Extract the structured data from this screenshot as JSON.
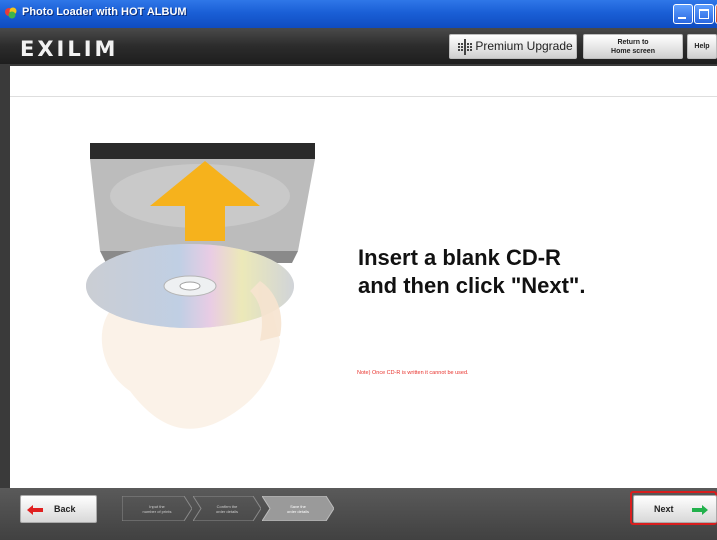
{
  "window": {
    "title": "Photo Loader with HOT ALBUM",
    "controls": [
      "minimize-icon",
      "maximize-icon",
      "close-icon"
    ]
  },
  "header": {
    "logo": "EXILIM",
    "premium_label": "Premium Upgrade",
    "home_label_line1": "Return to",
    "home_label_line2": "Home screen",
    "help_label": "Help"
  },
  "main": {
    "headline_line1": "Insert a blank CD-R",
    "headline_line2": "and then click \"Next\".",
    "note": "Note) Once CD-R is written it cannot be used."
  },
  "footer": {
    "back_label": "Back",
    "next_label": "Next",
    "steps": [
      {
        "line1": "Input the",
        "line2": "number of prints",
        "active": false
      },
      {
        "line1": "Confirm the",
        "line2": "order details",
        "active": false
      },
      {
        "line1": "Save the",
        "line2": "order details",
        "active": true
      }
    ]
  },
  "colors": {
    "titlebar": "#1a5fd6",
    "header": "#2c2c2c",
    "note_red": "#e8322c",
    "back_arrow": "#e02020",
    "next_arrow": "#22b14c",
    "next_highlight": "#d81e1e",
    "insert_arrow": "#f6b21c"
  }
}
